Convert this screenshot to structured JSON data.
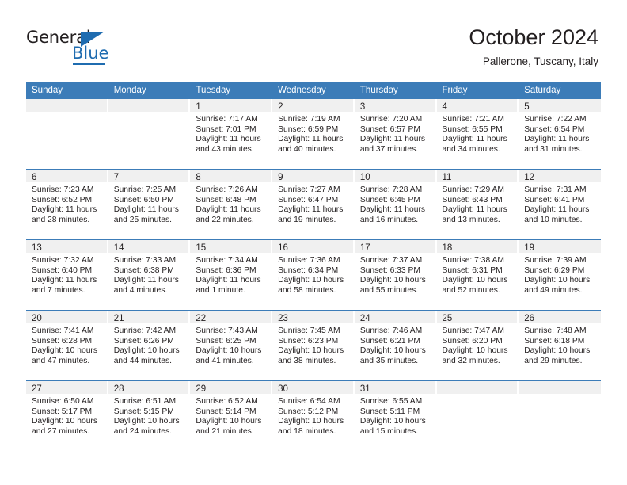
{
  "logo": {
    "word_top": "General",
    "word_bottom": "Blue",
    "accent_color": "#1f6cb0",
    "triangle_icon": "triangle-icon"
  },
  "header": {
    "title": "October 2024",
    "subtitle": "Pallerone, Tuscany, Italy"
  },
  "colors": {
    "header_blue": "#3c7cb8",
    "daynum_band": "#f0f0f0",
    "text": "#231f20"
  },
  "calendar": {
    "day_headers": [
      "Sunday",
      "Monday",
      "Tuesday",
      "Wednesday",
      "Thursday",
      "Friday",
      "Saturday"
    ],
    "weeks": [
      [
        {
          "day": "",
          "sunrise": "",
          "sunset": "",
          "daylight": "",
          "empty": true
        },
        {
          "day": "",
          "sunrise": "",
          "sunset": "",
          "daylight": "",
          "empty": true
        },
        {
          "day": "1",
          "sunrise": "Sunrise: 7:17 AM",
          "sunset": "Sunset: 7:01 PM",
          "daylight": "Daylight: 11 hours and 43 minutes."
        },
        {
          "day": "2",
          "sunrise": "Sunrise: 7:19 AM",
          "sunset": "Sunset: 6:59 PM",
          "daylight": "Daylight: 11 hours and 40 minutes."
        },
        {
          "day": "3",
          "sunrise": "Sunrise: 7:20 AM",
          "sunset": "Sunset: 6:57 PM",
          "daylight": "Daylight: 11 hours and 37 minutes."
        },
        {
          "day": "4",
          "sunrise": "Sunrise: 7:21 AM",
          "sunset": "Sunset: 6:55 PM",
          "daylight": "Daylight: 11 hours and 34 minutes."
        },
        {
          "day": "5",
          "sunrise": "Sunrise: 7:22 AM",
          "sunset": "Sunset: 6:54 PM",
          "daylight": "Daylight: 11 hours and 31 minutes."
        }
      ],
      [
        {
          "day": "6",
          "sunrise": "Sunrise: 7:23 AM",
          "sunset": "Sunset: 6:52 PM",
          "daylight": "Daylight: 11 hours and 28 minutes."
        },
        {
          "day": "7",
          "sunrise": "Sunrise: 7:25 AM",
          "sunset": "Sunset: 6:50 PM",
          "daylight": "Daylight: 11 hours and 25 minutes."
        },
        {
          "day": "8",
          "sunrise": "Sunrise: 7:26 AM",
          "sunset": "Sunset: 6:48 PM",
          "daylight": "Daylight: 11 hours and 22 minutes."
        },
        {
          "day": "9",
          "sunrise": "Sunrise: 7:27 AM",
          "sunset": "Sunset: 6:47 PM",
          "daylight": "Daylight: 11 hours and 19 minutes."
        },
        {
          "day": "10",
          "sunrise": "Sunrise: 7:28 AM",
          "sunset": "Sunset: 6:45 PM",
          "daylight": "Daylight: 11 hours and 16 minutes."
        },
        {
          "day": "11",
          "sunrise": "Sunrise: 7:29 AM",
          "sunset": "Sunset: 6:43 PM",
          "daylight": "Daylight: 11 hours and 13 minutes."
        },
        {
          "day": "12",
          "sunrise": "Sunrise: 7:31 AM",
          "sunset": "Sunset: 6:41 PM",
          "daylight": "Daylight: 11 hours and 10 minutes."
        }
      ],
      [
        {
          "day": "13",
          "sunrise": "Sunrise: 7:32 AM",
          "sunset": "Sunset: 6:40 PM",
          "daylight": "Daylight: 11 hours and 7 minutes."
        },
        {
          "day": "14",
          "sunrise": "Sunrise: 7:33 AM",
          "sunset": "Sunset: 6:38 PM",
          "daylight": "Daylight: 11 hours and 4 minutes."
        },
        {
          "day": "15",
          "sunrise": "Sunrise: 7:34 AM",
          "sunset": "Sunset: 6:36 PM",
          "daylight": "Daylight: 11 hours and 1 minute."
        },
        {
          "day": "16",
          "sunrise": "Sunrise: 7:36 AM",
          "sunset": "Sunset: 6:34 PM",
          "daylight": "Daylight: 10 hours and 58 minutes."
        },
        {
          "day": "17",
          "sunrise": "Sunrise: 7:37 AM",
          "sunset": "Sunset: 6:33 PM",
          "daylight": "Daylight: 10 hours and 55 minutes."
        },
        {
          "day": "18",
          "sunrise": "Sunrise: 7:38 AM",
          "sunset": "Sunset: 6:31 PM",
          "daylight": "Daylight: 10 hours and 52 minutes."
        },
        {
          "day": "19",
          "sunrise": "Sunrise: 7:39 AM",
          "sunset": "Sunset: 6:29 PM",
          "daylight": "Daylight: 10 hours and 49 minutes."
        }
      ],
      [
        {
          "day": "20",
          "sunrise": "Sunrise: 7:41 AM",
          "sunset": "Sunset: 6:28 PM",
          "daylight": "Daylight: 10 hours and 47 minutes."
        },
        {
          "day": "21",
          "sunrise": "Sunrise: 7:42 AM",
          "sunset": "Sunset: 6:26 PM",
          "daylight": "Daylight: 10 hours and 44 minutes."
        },
        {
          "day": "22",
          "sunrise": "Sunrise: 7:43 AM",
          "sunset": "Sunset: 6:25 PM",
          "daylight": "Daylight: 10 hours and 41 minutes."
        },
        {
          "day": "23",
          "sunrise": "Sunrise: 7:45 AM",
          "sunset": "Sunset: 6:23 PM",
          "daylight": "Daylight: 10 hours and 38 minutes."
        },
        {
          "day": "24",
          "sunrise": "Sunrise: 7:46 AM",
          "sunset": "Sunset: 6:21 PM",
          "daylight": "Daylight: 10 hours and 35 minutes."
        },
        {
          "day": "25",
          "sunrise": "Sunrise: 7:47 AM",
          "sunset": "Sunset: 6:20 PM",
          "daylight": "Daylight: 10 hours and 32 minutes."
        },
        {
          "day": "26",
          "sunrise": "Sunrise: 7:48 AM",
          "sunset": "Sunset: 6:18 PM",
          "daylight": "Daylight: 10 hours and 29 minutes."
        }
      ],
      [
        {
          "day": "27",
          "sunrise": "Sunrise: 6:50 AM",
          "sunset": "Sunset: 5:17 PM",
          "daylight": "Daylight: 10 hours and 27 minutes."
        },
        {
          "day": "28",
          "sunrise": "Sunrise: 6:51 AM",
          "sunset": "Sunset: 5:15 PM",
          "daylight": "Daylight: 10 hours and 24 minutes."
        },
        {
          "day": "29",
          "sunrise": "Sunrise: 6:52 AM",
          "sunset": "Sunset: 5:14 PM",
          "daylight": "Daylight: 10 hours and 21 minutes."
        },
        {
          "day": "30",
          "sunrise": "Sunrise: 6:54 AM",
          "sunset": "Sunset: 5:12 PM",
          "daylight": "Daylight: 10 hours and 18 minutes."
        },
        {
          "day": "31",
          "sunrise": "Sunrise: 6:55 AM",
          "sunset": "Sunset: 5:11 PM",
          "daylight": "Daylight: 10 hours and 15 minutes."
        },
        {
          "day": "",
          "sunrise": "",
          "sunset": "",
          "daylight": "",
          "empty": true
        },
        {
          "day": "",
          "sunrise": "",
          "sunset": "",
          "daylight": "",
          "empty": true
        }
      ]
    ]
  }
}
